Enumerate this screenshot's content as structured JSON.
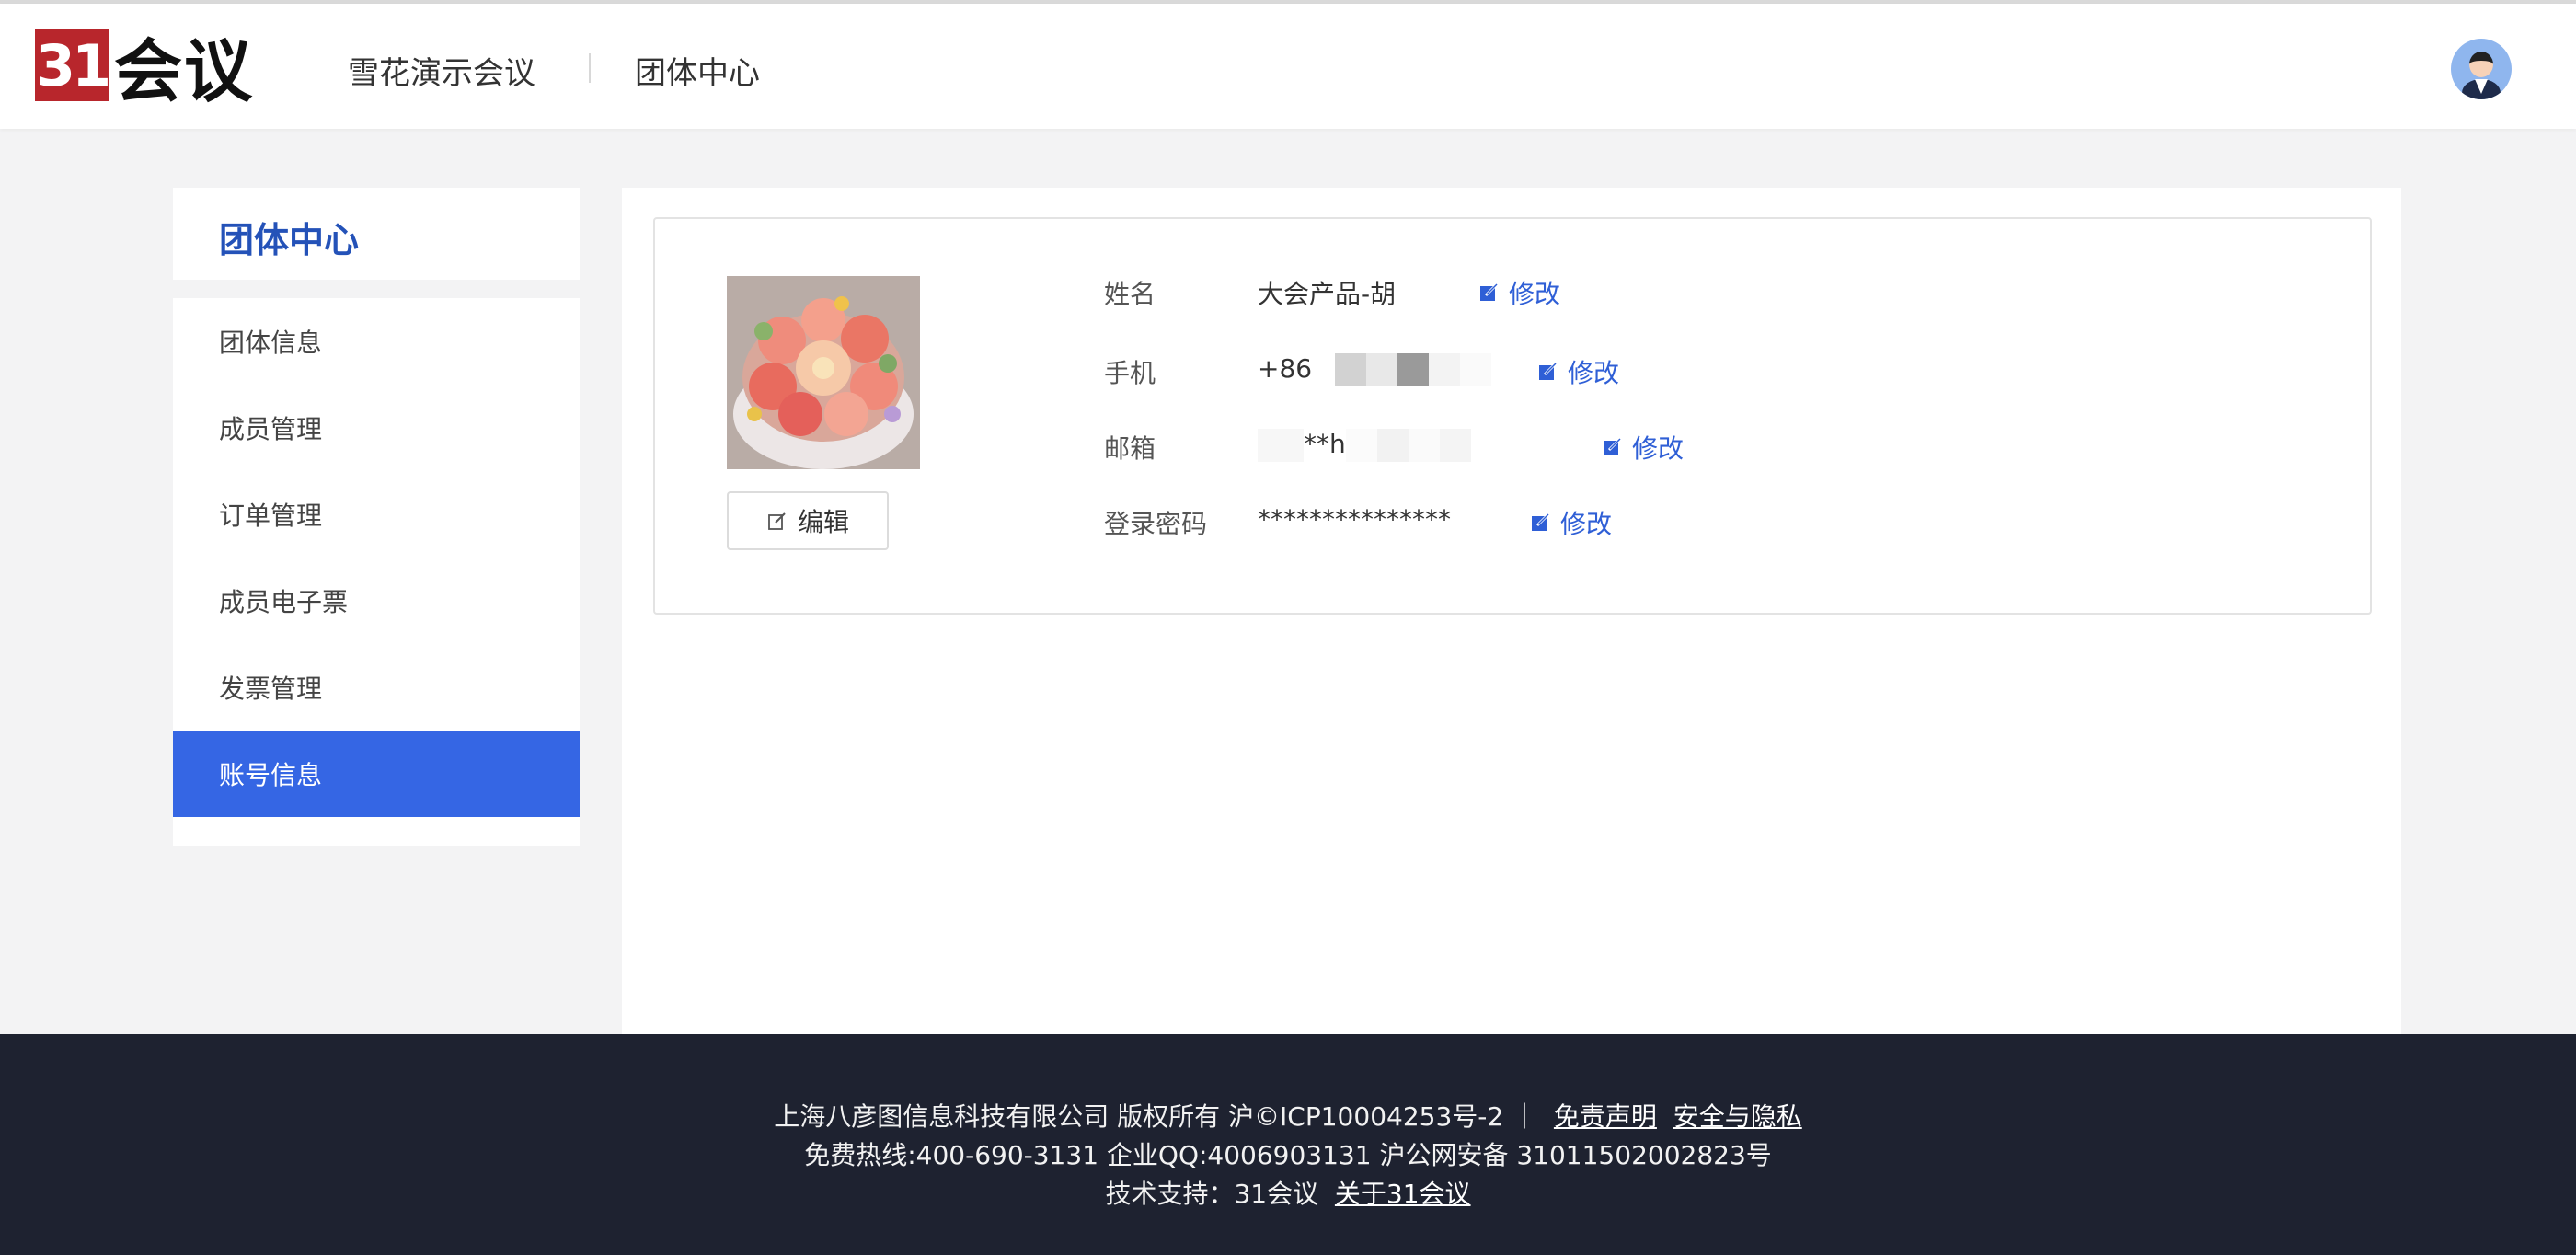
{
  "header": {
    "logo_number": "31",
    "logo_text": "会议",
    "site_name": "雪花演示会议",
    "center_name": "团体中心"
  },
  "sidebar": {
    "title": "团体中心",
    "items": [
      {
        "label": "团体信息",
        "active": false
      },
      {
        "label": "成员管理",
        "active": false
      },
      {
        "label": "订单管理",
        "active": false
      },
      {
        "label": "成员电子票",
        "active": false
      },
      {
        "label": "发票管理",
        "active": false
      },
      {
        "label": "账号信息",
        "active": true
      }
    ]
  },
  "account": {
    "edit_label": "编辑",
    "modify_label": "修改",
    "fields": [
      {
        "label": "姓名",
        "value": "大会产品-胡"
      },
      {
        "label": "手机",
        "value": "+86"
      },
      {
        "label": "邮箱",
        "value": "**h"
      },
      {
        "label": "登录密码",
        "value": "***************"
      }
    ]
  },
  "footer": {
    "line1": "上海八彦图信息科技有限公司 版权所有 沪©ICP10004253号-2 ｜",
    "disclaimer": "免责声明",
    "privacy": "安全与隐私",
    "line2": "免费热线:400-690-3131 企业QQ:4006903131 沪公网安备 31011502002823号",
    "support_prefix": "技术支持：31会议",
    "about": "关于31会议"
  },
  "colors": {
    "accent": "#3566e4",
    "link": "#2f5fd6",
    "brand_red": "#b8262c",
    "footer_bg": "#1e2230"
  },
  "icons": [
    "avatar-icon",
    "edit-pencil-icon",
    "modify-icon"
  ]
}
